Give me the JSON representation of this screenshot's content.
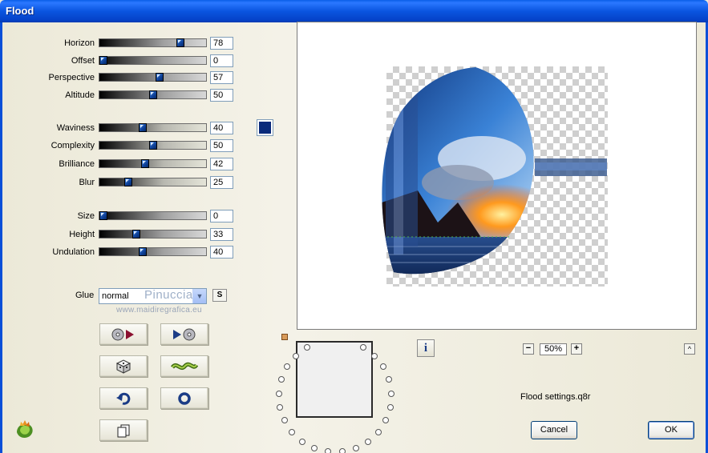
{
  "window": {
    "title": "Flood"
  },
  "sliders": [
    {
      "label": "Horizon",
      "value": "78",
      "fraction": 0.78,
      "style": "plain"
    },
    {
      "label": "Offset",
      "value": "0",
      "fraction": 0.0,
      "style": "plain"
    },
    {
      "label": "Perspective",
      "value": "57",
      "fraction": 0.57,
      "style": "plain"
    },
    {
      "label": "Altitude",
      "value": "50",
      "fraction": 0.5,
      "style": "plain"
    },
    {
      "label": "Waviness",
      "value": "40",
      "fraction": 0.4,
      "style": "alt"
    },
    {
      "label": "Complexity",
      "value": "50",
      "fraction": 0.5,
      "style": "alt"
    },
    {
      "label": "Brilliance",
      "value": "42",
      "fraction": 0.42,
      "style": "alt"
    },
    {
      "label": "Blur",
      "value": "25",
      "fraction": 0.25,
      "style": "alt"
    },
    {
      "label": "Size",
      "value": "0",
      "fraction": 0.0,
      "style": "plain"
    },
    {
      "label": "Height",
      "value": "33",
      "fraction": 0.33,
      "style": "plain"
    },
    {
      "label": "Undulation",
      "value": "40",
      "fraction": 0.4,
      "style": "plain"
    }
  ],
  "color_swatch": "#0a2a7a",
  "glue": {
    "label": "Glue",
    "value": "normal",
    "watermark": "Pinuccia",
    "url": "www.maidiregrafica.eu",
    "s_label": "S"
  },
  "icon_buttons": [
    {
      "name": "load-preset-icon"
    },
    {
      "name": "save-preset-icon"
    },
    {
      "name": "random-dice-icon"
    },
    {
      "name": "wave-icon"
    },
    {
      "name": "undo-icon"
    },
    {
      "name": "reset-icon"
    },
    {
      "name": "copy-icon"
    }
  ],
  "zoom": {
    "value": "50%",
    "minus": "−",
    "plus": "+"
  },
  "info_label": "i",
  "collapse_label": "^",
  "settings_file": "Flood settings.q8r",
  "buttons": {
    "cancel": "Cancel",
    "ok": "OK"
  }
}
